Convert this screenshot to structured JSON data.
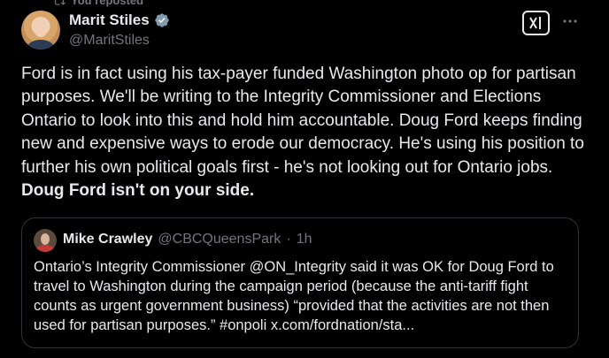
{
  "header": {
    "reposted_label": "You reposted"
  },
  "author": {
    "name": "Marit Stiles",
    "handle": "@MaritStiles",
    "verified_color": "#829aab"
  },
  "actions": {
    "grok_icon": "grok-icon",
    "more_icon": "more-icon"
  },
  "tweet": {
    "text": "Ford is in fact using his tax-payer funded Washington photo op for partisan purposes. We'll be writing to the Integrity Commissioner and Elections Ontario to look into this and hold him accountable. Doug Ford keeps finding new and expensive ways to erode our democracy. He's using his position to further his own political goals first - he's not looking out for Ontario jobs. ",
    "bold_text": "Doug Ford isn't on your side."
  },
  "quote": {
    "name": "Mike Crawley",
    "handle": "@CBCQueensPark",
    "separator": "·",
    "time": "1h",
    "text": "Ontario’s Integrity Commissioner @ON_Integrity said it was OK for Doug Ford to travel to Washington during the campaign period (because the anti-tariff fight counts as urgent government business) “provided that the activities are not then used for partisan purposes.” #onpoli x.com/fordnation/sta..."
  },
  "colors": {
    "background": "#000000",
    "text": "#e7e9ea",
    "muted": "#71767b",
    "border": "#2f3336"
  }
}
